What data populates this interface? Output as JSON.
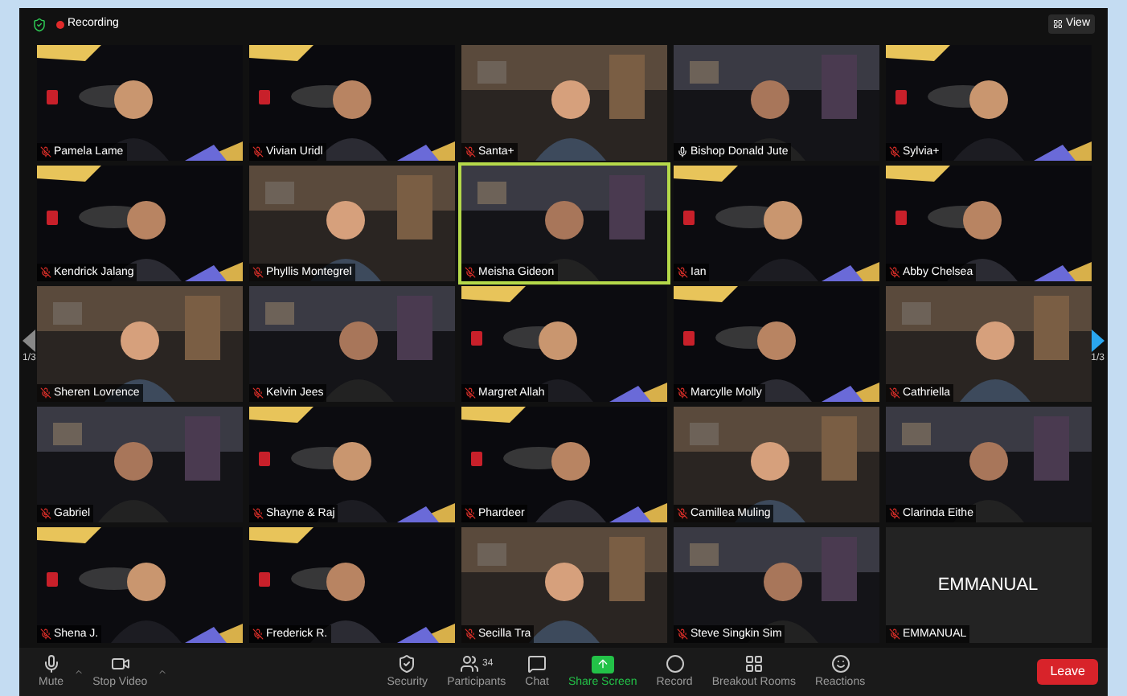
{
  "top_bar": {
    "recording_label": "Recording",
    "view_button": "View"
  },
  "pager": {
    "left": {
      "label": "1/3",
      "disabled": true
    },
    "right": {
      "label": "1/3",
      "disabled": false
    }
  },
  "tiles": [
    {
      "name": "Pamela Lame",
      "muted": true,
      "speaking": false,
      "kind": "video"
    },
    {
      "name": "Vivian Uridl",
      "muted": true,
      "speaking": false,
      "kind": "video"
    },
    {
      "name": "Santa+",
      "muted": true,
      "speaking": false,
      "kind": "video"
    },
    {
      "name": "Bishop Donald Jute",
      "muted": false,
      "speaking": false,
      "kind": "video"
    },
    {
      "name": "Sylvia+",
      "muted": true,
      "speaking": false,
      "kind": "video"
    },
    {
      "name": "Kendrick Jalang",
      "muted": true,
      "speaking": false,
      "kind": "video"
    },
    {
      "name": "Phyllis Montegrel",
      "muted": true,
      "speaking": false,
      "kind": "video"
    },
    {
      "name": "Meisha Gideon",
      "muted": true,
      "speaking": true,
      "kind": "video"
    },
    {
      "name": "Ian",
      "muted": true,
      "speaking": false,
      "kind": "video"
    },
    {
      "name": "Abby Chelsea",
      "muted": true,
      "speaking": false,
      "kind": "video"
    },
    {
      "name": "Sheren Lovrence",
      "muted": true,
      "speaking": false,
      "kind": "video"
    },
    {
      "name": "Kelvin Jees",
      "muted": true,
      "speaking": false,
      "kind": "video"
    },
    {
      "name": "Margret Allah",
      "muted": true,
      "speaking": false,
      "kind": "video"
    },
    {
      "name": "Marcylle Molly",
      "muted": true,
      "speaking": false,
      "kind": "video"
    },
    {
      "name": "Cathriella",
      "muted": true,
      "speaking": false,
      "kind": "video"
    },
    {
      "name": "Gabriel",
      "muted": true,
      "speaking": false,
      "kind": "video"
    },
    {
      "name": "Shayne & Raj",
      "muted": true,
      "speaking": false,
      "kind": "video"
    },
    {
      "name": "Phardeer",
      "muted": true,
      "speaking": false,
      "kind": "video"
    },
    {
      "name": "Camillea Muling",
      "muted": true,
      "speaking": false,
      "kind": "video"
    },
    {
      "name": "Clarinda Eithe",
      "muted": true,
      "speaking": false,
      "kind": "video"
    },
    {
      "name": "Shena J.",
      "muted": true,
      "speaking": false,
      "kind": "video"
    },
    {
      "name": "Frederick R.",
      "muted": true,
      "speaking": false,
      "kind": "video"
    },
    {
      "name": "Secilla Tra",
      "muted": true,
      "speaking": false,
      "kind": "video"
    },
    {
      "name": "Steve Singkin Sim",
      "muted": true,
      "speaking": false,
      "kind": "video"
    },
    {
      "name": "EMMANUAL",
      "muted": true,
      "speaking": false,
      "kind": "no_video"
    }
  ],
  "camera_off_caption": "EMMANUAL",
  "toolbar": {
    "left": [
      {
        "label": "Mute",
        "kind": "mic"
      },
      {
        "label": "Stop Video",
        "kind": "video"
      }
    ],
    "center": [
      {
        "label": "Security",
        "kind": "shield"
      },
      {
        "label": "Participants",
        "kind": "people",
        "count": "34"
      },
      {
        "label": "Chat",
        "kind": "chat"
      },
      {
        "label": "Share Screen",
        "kind": "share"
      },
      {
        "label": "Record",
        "kind": "record"
      },
      {
        "label": "Breakout Rooms",
        "kind": "rooms"
      },
      {
        "label": "Reactions",
        "kind": "react"
      }
    ],
    "leave_button": "Leave"
  }
}
